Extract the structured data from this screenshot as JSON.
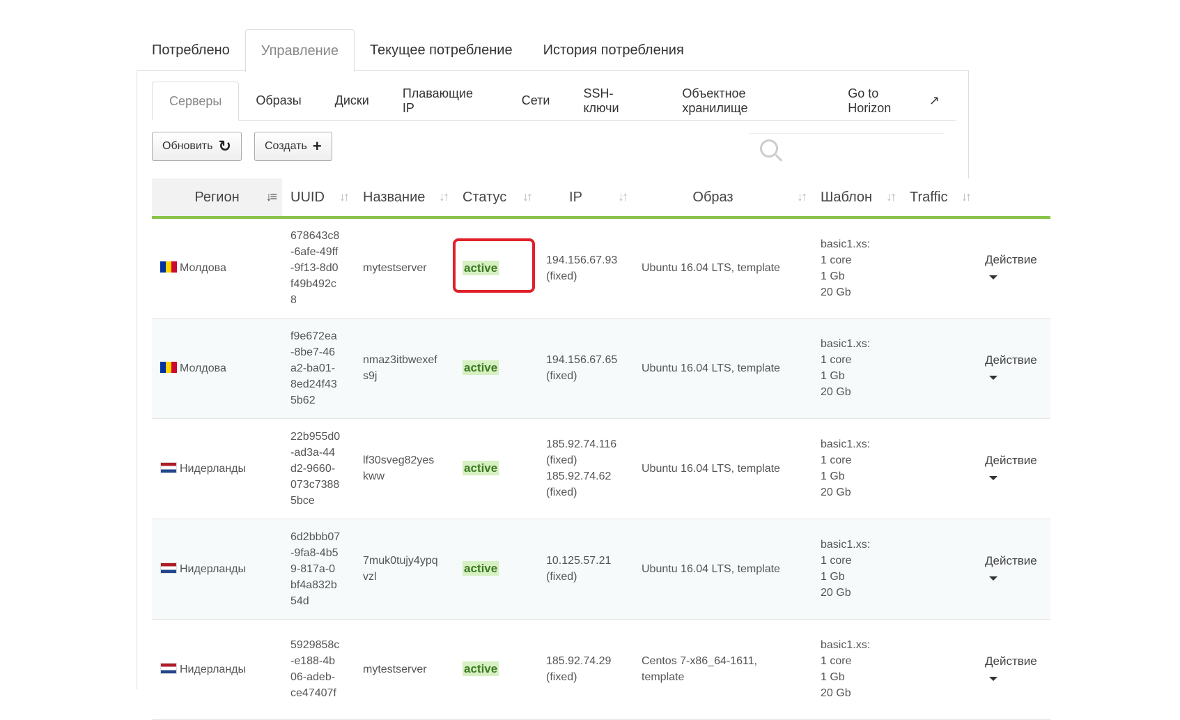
{
  "top_tabs": [
    "Потреблено",
    "Управление",
    "Текущее потребление",
    "История потребления"
  ],
  "sub_tabs": [
    "Серверы",
    "Образы",
    "Диски",
    "Плавающие IP",
    "Сети",
    "SSH-ключи",
    "Объектное хранилище",
    "Go to Horizon"
  ],
  "toolbar": {
    "refresh_label": "Обновить",
    "create_label": "Создать",
    "search_placeholder": ""
  },
  "columns": [
    "Регион",
    "UUID",
    "Название",
    "Статус",
    "IP",
    "Образ",
    "Шаблон",
    "Traffic"
  ],
  "rows": [
    {
      "region": "Молдова",
      "flag": "md",
      "uuid": [
        "678643c8",
        "-6afe-49ff",
        "-9f13-8d0",
        "f49b492c",
        "8"
      ],
      "name": [
        "mytestserver"
      ],
      "status": "active",
      "ip": [
        "194.156.67.93",
        "(fixed)"
      ],
      "image": [
        "Ubuntu 16.04 LTS, template"
      ],
      "template": [
        "basic1.xs:",
        "1 core",
        "1 Gb",
        "20 Gb"
      ],
      "traffic": "",
      "action": "Действие"
    },
    {
      "region": "Молдова",
      "flag": "md",
      "uuid": [
        "f9e672ea",
        "-8be7-46",
        "a2-ba01-",
        "8ed24f43",
        "5b62"
      ],
      "name": [
        "nmaz3itbwexef",
        "s9j"
      ],
      "status": "active",
      "ip": [
        "194.156.67.65",
        "(fixed)"
      ],
      "image": [
        "Ubuntu 16.04 LTS, template"
      ],
      "template": [
        "basic1.xs:",
        "1 core",
        "1 Gb",
        "20 Gb"
      ],
      "traffic": "",
      "action": "Действие"
    },
    {
      "region": "Нидерланды",
      "flag": "nl",
      "uuid": [
        "22b955d0",
        "-ad3a-44",
        "d2-9660-",
        "073c7388",
        "5bce"
      ],
      "name": [
        "lf30sveg82yes",
        "kww"
      ],
      "status": "active",
      "ip": [
        "185.92.74.116",
        "(fixed)",
        "185.92.74.62",
        "(fixed)"
      ],
      "image": [
        "Ubuntu 16.04 LTS, template"
      ],
      "template": [
        "basic1.xs:",
        "1 core",
        "1 Gb",
        "20 Gb"
      ],
      "traffic": "",
      "action": "Действие"
    },
    {
      "region": "Нидерланды",
      "flag": "nl",
      "uuid": [
        "6d2bbb07",
        "-9fa8-4b5",
        "9-817a-0",
        "bf4a832b",
        "54d"
      ],
      "name": [
        "7muk0tujy4ypq",
        "vzl"
      ],
      "status": "active",
      "ip": [
        "10.125.57.21",
        "(fixed)"
      ],
      "image": [
        "Ubuntu 16.04 LTS, template"
      ],
      "template": [
        "basic1.xs:",
        "1 core",
        "1 Gb",
        "20 Gb"
      ],
      "traffic": "",
      "action": "Действие"
    },
    {
      "region": "Нидерланды",
      "flag": "nl",
      "uuid": [
        "5929858c",
        "-e188-4b",
        "06-adeb-",
        "ce47407f"
      ],
      "name": [
        "mytestserver"
      ],
      "status": "active",
      "ip": [
        "185.92.74.29",
        "(fixed)"
      ],
      "image": [
        "Centos 7-x86_64-1611,",
        "template"
      ],
      "template": [
        "basic1.xs:",
        "1 core",
        "1 Gb",
        "20 Gb"
      ],
      "traffic": "",
      "action": "Действие"
    }
  ],
  "colors": {
    "accent_green": "#8bc34a",
    "status_bg": "#d6f0c2",
    "highlight_red": "#e0202a"
  }
}
